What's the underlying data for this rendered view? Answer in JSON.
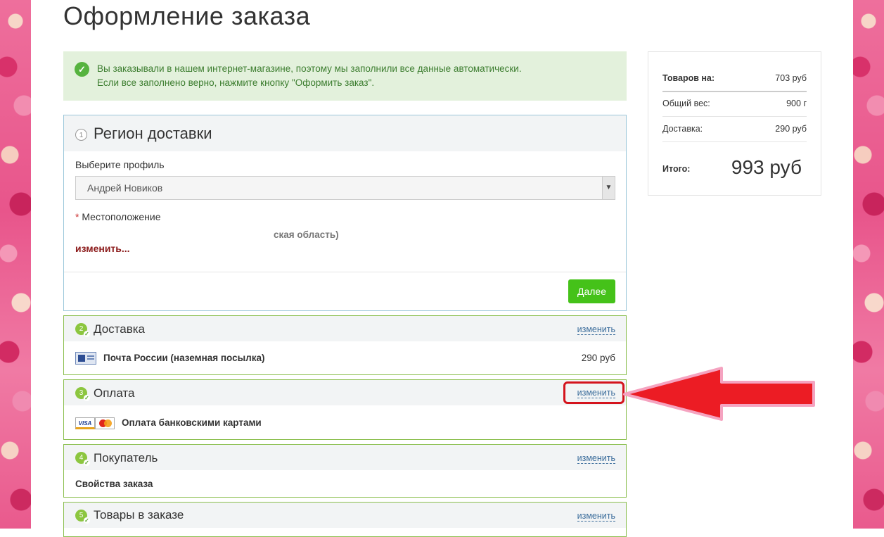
{
  "page": {
    "title": "Оформление заказа"
  },
  "alert": {
    "line1": "Вы заказывали в нашем интернет-магазине, поэтому мы заполнили все данные автоматически.",
    "line2": "Если все заполнено верно, нажмите кнопку \"Оформить заказ\".",
    "icon": "check-circle-icon"
  },
  "region": {
    "number": "1",
    "title": "Регион доставки",
    "profile_label": "Выберите профиль",
    "profile_value": "Андрей Новиков",
    "location_required_mark": "*",
    "location_label": "Местоположение",
    "location_value": "ская область)",
    "change_link": "изменить...",
    "next_button": "Далее"
  },
  "delivery": {
    "number": "2",
    "title": "Доставка",
    "edit": "изменить",
    "method": "Почта России (наземная посылка)",
    "price": "290 руб",
    "icon": "russian-post-icon"
  },
  "payment": {
    "number": "3",
    "title": "Оплата",
    "edit": "изменить",
    "method": "Оплата банковскими картами",
    "visa_text": "VISA",
    "icons": [
      "visa-icon",
      "mastercard-icon"
    ]
  },
  "buyer": {
    "number": "4",
    "title": "Покупатель",
    "edit": "изменить",
    "properties": "Свойства заказа"
  },
  "items": {
    "number": "5",
    "title": "Товары в заказе",
    "edit": "изменить"
  },
  "summary": {
    "goods_label": "Товаров на:",
    "goods_value": "703 руб",
    "weight_label": "Общий вес:",
    "weight_value": "900 г",
    "shipping_label": "Доставка:",
    "shipping_value": "290 руб",
    "total_label": "Итого:",
    "total_value": "993 руб"
  },
  "annotation": {
    "highlight_color": "#d4141d",
    "arrow_color": "#ec1c24",
    "arrow_outline": "#f5a3c0"
  }
}
